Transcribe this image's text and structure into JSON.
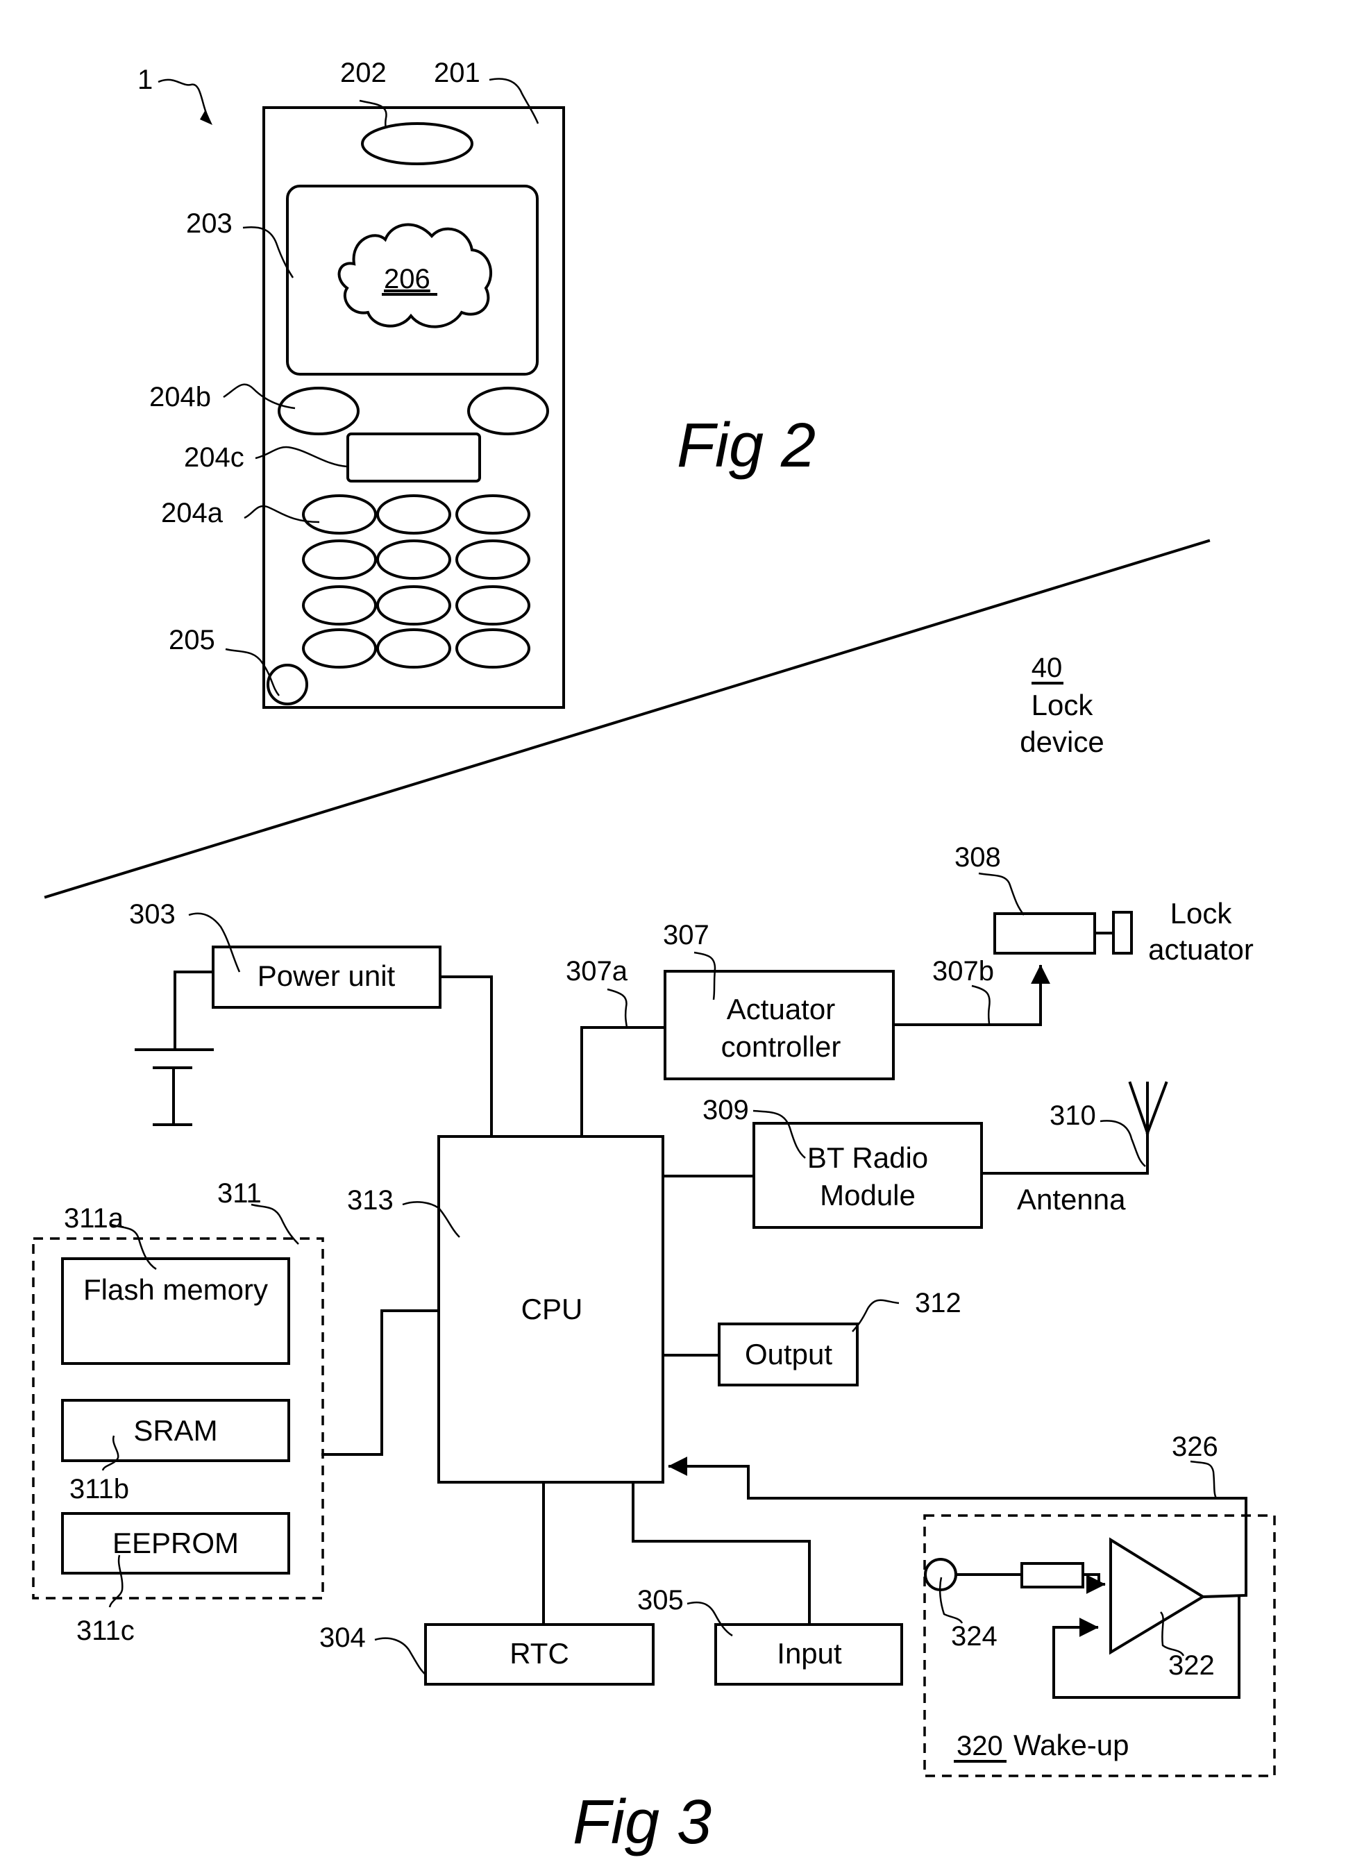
{
  "figures": {
    "fig2": {
      "caption": "Fig 2",
      "device_ref": "1",
      "refs": {
        "housing": "201",
        "speaker": "202",
        "display": "203",
        "display_content": "206",
        "soft_keys": "204b",
        "nav_key": "204c",
        "keypad": "204a",
        "microphone": "205"
      },
      "keypad": {
        "rows": 4,
        "cols": 3
      }
    },
    "fig3": {
      "caption": "Fig 3",
      "lock_device": {
        "ref": "40",
        "label_line1": "Lock",
        "label_line2": "device"
      },
      "blocks": {
        "power_unit": {
          "ref": "303",
          "label": "Power unit"
        },
        "actuator_controller": {
          "ref": "307",
          "label_line1": "Actuator",
          "label_line2": "controller"
        },
        "lock_actuator": {
          "ref": "308",
          "label_line1": "Lock",
          "label_line2": "actuator"
        },
        "bt_radio": {
          "ref": "309",
          "label_line1": "BT Radio",
          "label_line2": "Module"
        },
        "antenna": {
          "ref": "310",
          "label": "Antenna"
        },
        "cpu": {
          "ref": "313",
          "label": "CPU"
        },
        "output": {
          "ref": "312",
          "label": "Output"
        },
        "memory": {
          "ref": "311"
        },
        "flash": {
          "ref": "311a",
          "label": "Flash memory"
        },
        "sram": {
          "ref": "311b",
          "label": "SRAM"
        },
        "eeprom": {
          "ref": "311c",
          "label": "EEPROM"
        },
        "rtc": {
          "ref": "304",
          "label": "RTC"
        },
        "input": {
          "ref": "305",
          "label": "Input"
        },
        "wakeup": {
          "ref": "320",
          "label": "Wake-up"
        },
        "amplifier": {
          "ref": "322"
        },
        "sensor": {
          "ref": "324"
        },
        "wake_line": {
          "ref": "326"
        }
      },
      "signals": {
        "actuator_in": "307a",
        "actuator_out": "307b"
      }
    }
  }
}
